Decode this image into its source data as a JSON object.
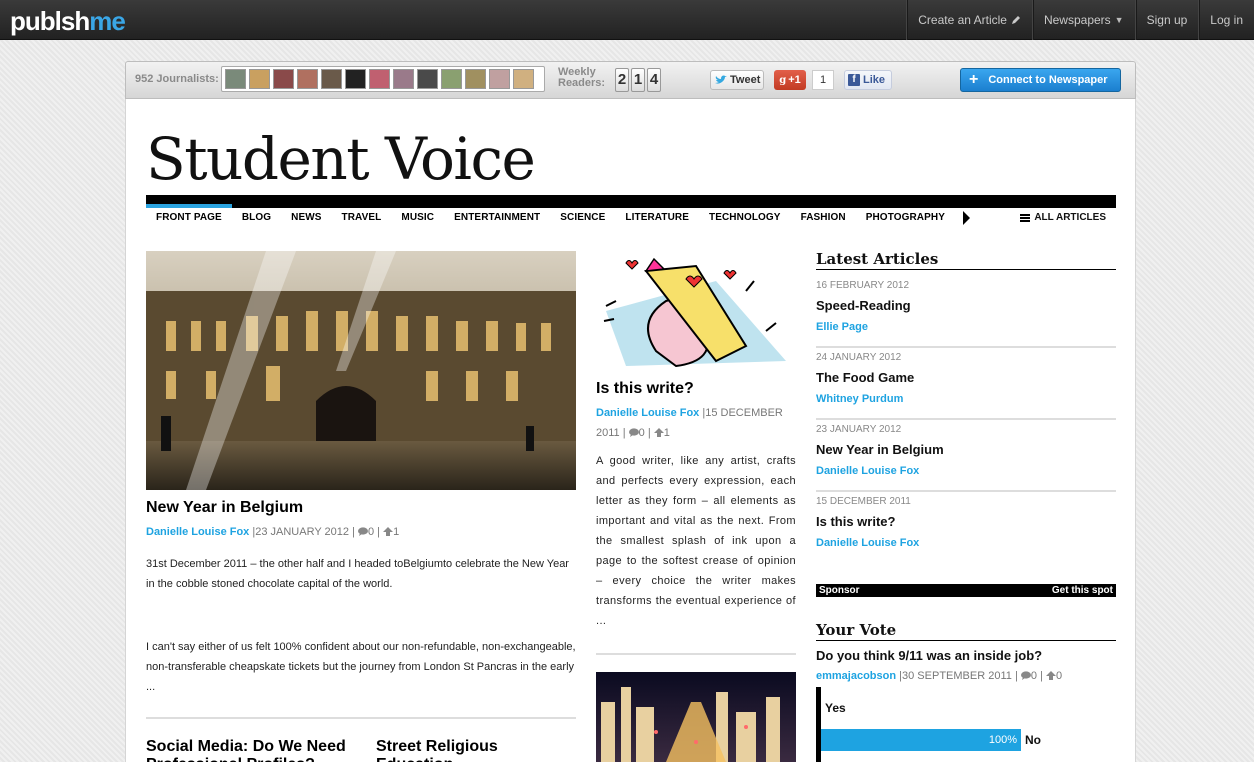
{
  "topbar": {
    "logo_a": "publsh",
    "logo_b": "me",
    "nav": [
      {
        "label": "Create an Article",
        "icon": "pencil-icon"
      },
      {
        "label": "Newspapers",
        "icon": "caret-down-icon"
      },
      {
        "label": "Sign up"
      },
      {
        "label": "Log in"
      }
    ]
  },
  "socialbar": {
    "journalists": "952 Journalists:",
    "avatar_colors": [
      "#7a8a7a",
      "#c9a060",
      "#8a4a4a",
      "#b07060",
      "#6a5a4a",
      "#222222",
      "#c06070",
      "#9a7a8a",
      "#4a4a4a",
      "#8aa070",
      "#a09060",
      "#c0a0a0",
      "#d0b080"
    ],
    "weekly_1": "Weekly",
    "weekly_2": "Readers:",
    "readers_digits": [
      "2",
      "1",
      "4"
    ],
    "tweet": "Tweet",
    "gplus": "+1",
    "gplus_count": "1",
    "like": "Like",
    "connect": "Connect to Newspaper"
  },
  "paper": {
    "masthead": "Student Voice",
    "nav": [
      "FRONT PAGE",
      "BLOG",
      "NEWS",
      "TRAVEL",
      "MUSIC",
      "ENTERTAINMENT",
      "SCIENCE",
      "LITERATURE",
      "TECHNOLOGY",
      "FASHION",
      "PHOTOGRAPHY"
    ],
    "all_articles": "ALL ARTICLES"
  },
  "main_article": {
    "title": "New Year in Belgium",
    "author": "Danielle Louise Fox",
    "date": "23 JANUARY 2012",
    "comments": "0",
    "votes": "1",
    "p1": "31st December 2011 – the other half and I headed toBelgiumto celebrate the New Year in the cobble stoned chocolate capital of the world.",
    "p2": " I can't say either of us felt 100% confident about our non-refundable, non-exchangeable, non-transferable cheapskate tickets but the journey from London St Pancras in the early ..."
  },
  "lower_titles": [
    "Social Media: Do We Need Professional Profiles?",
    "Street Religious Education"
  ],
  "mid_article": {
    "title": "Is this write?",
    "author": "Danielle Louise Fox",
    "date": "15 DECEMBER 2011",
    "comments": "0",
    "votes": "1",
    "text": "A good writer, like any artist, crafts and perfects every expression, each letter as they form – all elements as important and vital as the next. From the smallest splash of ink upon a page to the softest crease of opinion – every choice the writer makes transforms the eventual experience of ..."
  },
  "sidebar": {
    "latest_heading": "Latest Articles",
    "latest": [
      {
        "date": "16 FEBRUARY 2012",
        "title": "Speed-Reading",
        "author": "Ellie Page"
      },
      {
        "date": "24 JANUARY 2012",
        "title": "The Food Game",
        "author": "Whitney Purdum"
      },
      {
        "date": "23 JANUARY 2012",
        "title": "New Year in Belgium",
        "author": "Danielle Louise Fox"
      },
      {
        "date": "15 DECEMBER 2011",
        "title": "Is this write?",
        "author": "Danielle Louise Fox"
      }
    ],
    "sponsor": "Sponsor",
    "get_spot": "Get this spot",
    "vote_heading": "Your Vote",
    "vote_question": "Do you think 9/11 was an inside job?",
    "vote_author": "emmajacobson",
    "vote_date": "30 SEPTEMBER 2011",
    "vote_comments": "0",
    "vote_votes": "0",
    "options": [
      {
        "label": "Yes",
        "fraction": 0
      },
      {
        "label": "No",
        "fraction": 1,
        "pct_label": "100%"
      }
    ]
  },
  "colors": {
    "accent": "#1ea3e1",
    "brand_blue": "#3aa6e6"
  }
}
